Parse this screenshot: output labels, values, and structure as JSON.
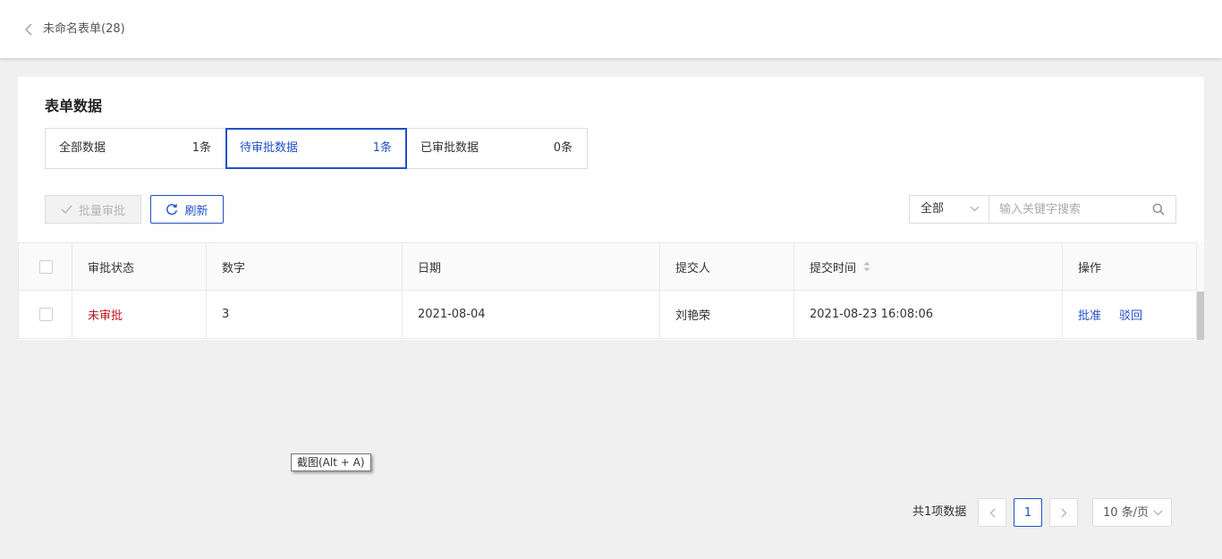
{
  "header": {
    "title": "未命名表单(28)"
  },
  "section": {
    "title": "表单数据"
  },
  "stat_tabs": [
    {
      "label": "全部数据",
      "count": "1条"
    },
    {
      "label": "待审批数据",
      "count": "1条"
    },
    {
      "label": "已审批数据",
      "count": "0条"
    }
  ],
  "toolbar": {
    "batch_label": "批量审批",
    "refresh_label": "刷新",
    "scope_value": "全部",
    "search_placeholder": "输入关键字搜索"
  },
  "table": {
    "headers": [
      "审批状态",
      "数字",
      "日期",
      "提交人",
      "提交时间",
      "操作"
    ],
    "rows": [
      {
        "status": "未审批",
        "number": "3",
        "date": "2021-08-04",
        "submitter": "刘艳荣",
        "submit_time": "2021-08-23 16:08:06",
        "actions": [
          "批准",
          "驳回"
        ]
      }
    ]
  },
  "tooltip": {
    "text": "截图(Alt + A)"
  },
  "pagination": {
    "total_text": "共1项数据",
    "current_page": "1",
    "page_size": "10 条/页"
  },
  "colors": {
    "accent": "#2150c8",
    "pending_status": "#c0141c",
    "background": "#f0f0f0"
  },
  "icons": {
    "back": "chevron-left-icon",
    "batch": "check-icon",
    "refresh": "refresh-icon",
    "search": "search-icon",
    "sort": "sort-icon",
    "dropdown": "chevron-down-icon"
  }
}
